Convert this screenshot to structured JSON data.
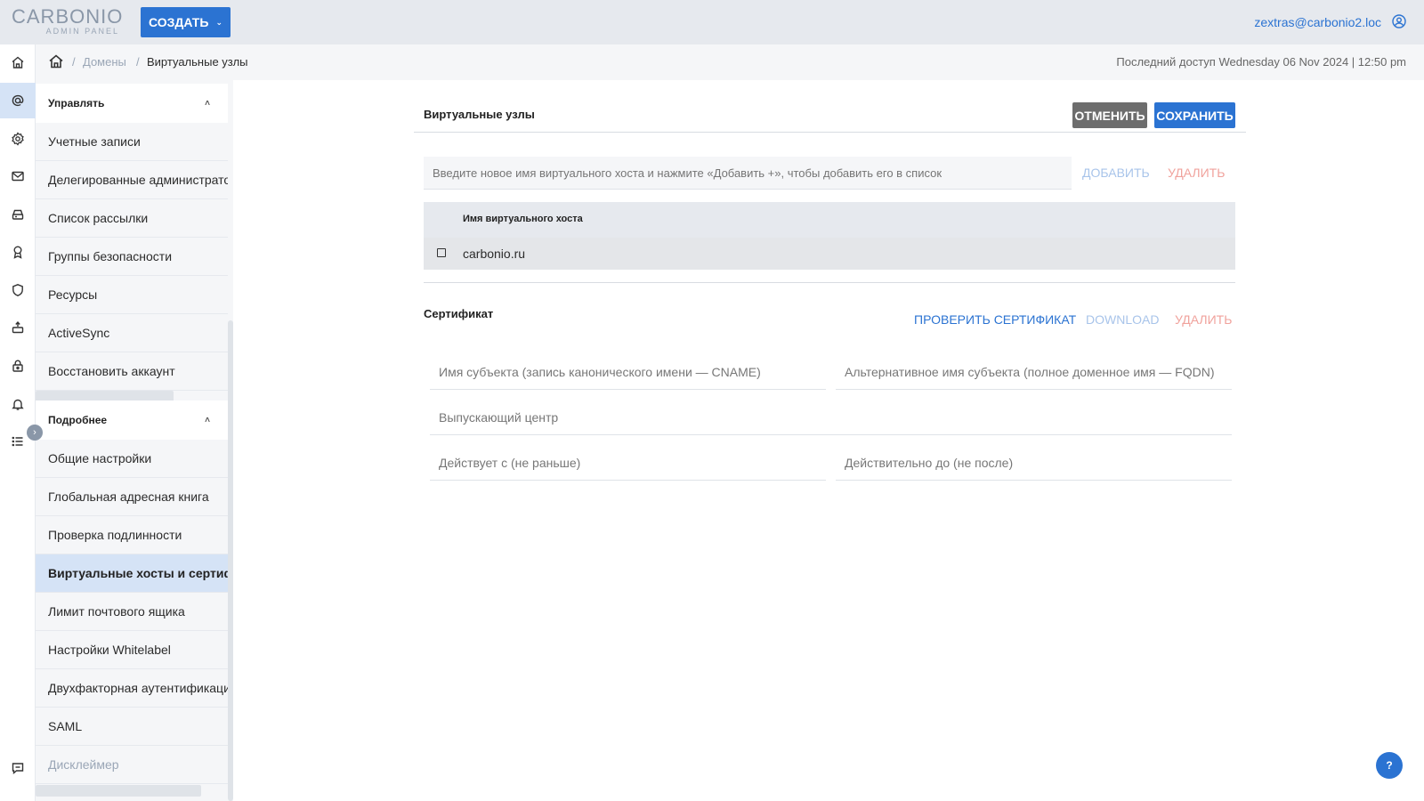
{
  "header": {
    "logo_main": "CARBONIO",
    "logo_sub": "ADMIN PANEL",
    "create_label": "СОЗДАТЬ",
    "user_email": "zextras@carbonio2.loc"
  },
  "breadcrumb": {
    "domains": "Домены",
    "current": "Виртуальные узлы",
    "separator": "/"
  },
  "last_access": "Последний доступ Wednesday 06 Nov 2024 | 12:50 pm",
  "rail": {
    "icons": [
      "home-icon",
      "at-icon",
      "gear-icon",
      "mail-icon",
      "storage-icon",
      "cos-icon",
      "shield-icon",
      "backup-icon",
      "lock-icon",
      "bell-icon",
      "list-icon",
      "chat-icon"
    ]
  },
  "sidebar": {
    "manage_title": "Управлять",
    "manage_items": [
      "Учетные записи",
      "Делегированные администрато",
      "Список рассылки",
      "Группы безопасности",
      "Ресурсы",
      "ActiveSync",
      "Восстановить аккаунт"
    ],
    "details_title": "Подробнее",
    "details_items": [
      "Общие настройки",
      "Глобальная адресная книга",
      "Проверка подлинности",
      "Виртуальные хосты и сертифик",
      "Лимит почтового ящика",
      "Настройки Whitelabel",
      "Двухфакторная аутентификация",
      "SAML",
      "Дисклеймер"
    ]
  },
  "main": {
    "title": "Виртуальные узлы",
    "cancel_label": "ОТМЕНИТЬ",
    "save_label": "СОХРАНИТЬ",
    "vh_placeholder": "Введите новое имя виртуального хоста и нажмите «Добавить +», чтобы добавить его в список",
    "add_label": "ДОБАВИТЬ",
    "delete_label": "УДАЛИТЬ",
    "table_header": "Имя виртуального хоста",
    "rows": [
      "carbonio.ru"
    ]
  },
  "certificate": {
    "title": "Сертификат",
    "check_label": "ПРОВЕРИТЬ СЕРТИФИКАТ",
    "download_label": "DOWNLOAD",
    "delete_label": "УДАЛИТЬ",
    "subject_name": "Имя субъекта (запись канонического имени — CNAME)",
    "alt_name": "Альтернативное имя субъекта (полное доменное имя — FQDN)",
    "issuer": "Выпускающий центр",
    "valid_from": "Действует с (не раньше)",
    "valid_to": "Действительно до (не после)"
  },
  "help_label": "?",
  "colors": {
    "accent": "#2b73d2",
    "cancel": "#6d6d6d",
    "danger_light": "#f0a29c",
    "accent_light": "#a8c4ea"
  }
}
